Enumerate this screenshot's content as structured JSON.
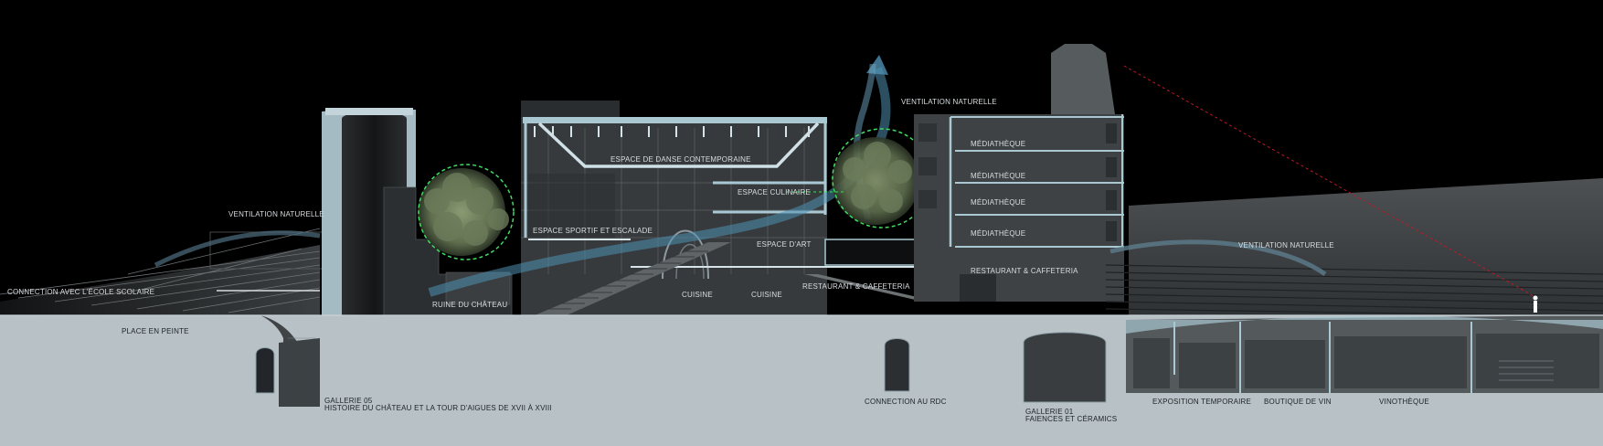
{
  "labels": {
    "ventilation_left": "VENTILATION NATURELLE",
    "ventilation_top": "VENTILATION NATURELLE",
    "ventilation_right": "VENTILATION NATURELLE",
    "connection_ecole": "CONNECTION AVEC L'ÉCOLE SCOLAIRE",
    "place_pente": "PLACE EN PEINTE",
    "ruine_chateau": "RUINE DU CHÂTEAU",
    "espace_danse": "ESPACE DE DANSE CONTEMPORAINE",
    "espace_culinaire": "ESPACE CULINAIRE",
    "espace_sportif": "ESPACE SPORTIF ET ESCALADE",
    "espace_art": "ESPACE D'ART",
    "cuisine_1": "CUISINE",
    "cuisine_2": "CUISINE",
    "restaurant_low": "RESTAURANT & CAFFETERIA",
    "restaurant_high": "RESTAURANT & CAFFETERIA",
    "mediatheque_1": "MÉDIATHÈQUE",
    "mediatheque_2": "MÉDIATHÈQUE",
    "mediatheque_3": "MÉDIATHÈQUE",
    "mediatheque_4": "MÉDIATHÈQUE",
    "gallerie05_title": "GALLERIE 05",
    "gallerie05_sub": "HISTOIRE DU CHÂTEAU ET LA TOUR D'AIGUES DE XVII À XVIII",
    "connection_rdc": "CONNECTION AU RDC",
    "gallerie01_title": "GALLERIE 01",
    "gallerie01_sub": "FAIENCES ET CÉRAMICS",
    "exposition": "EXPOSITION TEMPORAIRE",
    "boutique": "BOUTIQUE DE VIN",
    "vinotheque": "VINOTHÈQUE"
  },
  "colors": {
    "background": "#000000",
    "ground": "#b8c1c5",
    "structure": "#a9c8d2",
    "accent_blue": "#4f8fb0",
    "vegetation_ring": "#3fdc62",
    "sightline": "#c0182a"
  }
}
